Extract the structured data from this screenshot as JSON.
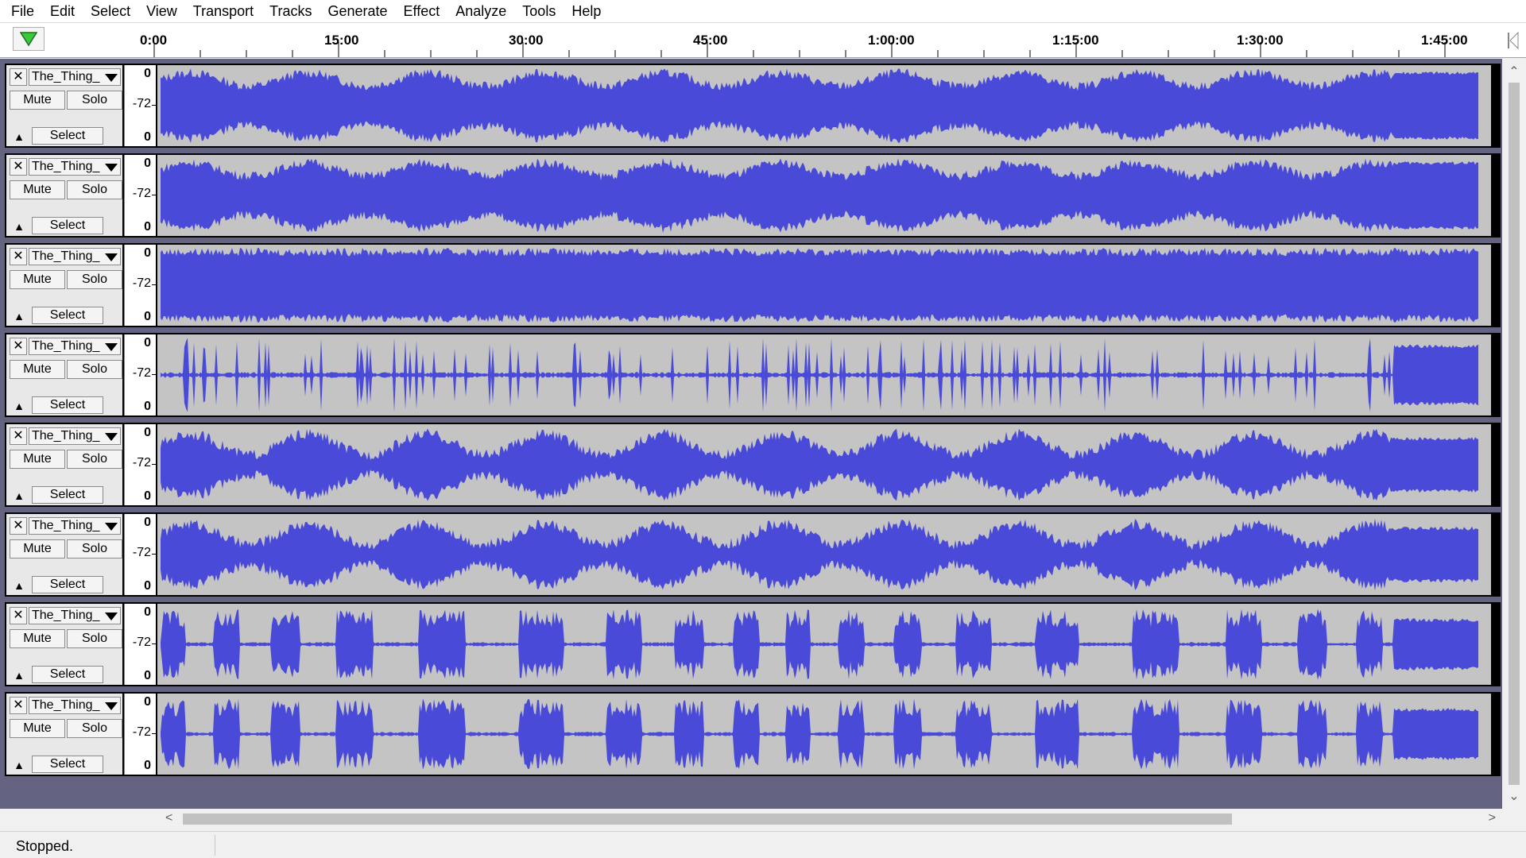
{
  "menu": [
    "File",
    "Edit",
    "Select",
    "View",
    "Transport",
    "Tracks",
    "Generate",
    "Effect",
    "Analyze",
    "Tools",
    "Help"
  ],
  "ruler": {
    "labels": [
      "0:00",
      "15:00",
      "30:00",
      "45:00",
      "1:00:00",
      "1:15:00",
      "1:30:00",
      "1:45:00"
    ],
    "play_icon": "play-triangle-icon"
  },
  "track_common": {
    "close_glyph": "✕",
    "mute_label": "Mute",
    "solo_label": "Solo",
    "select_label": "Select",
    "collapse_glyph": "▲",
    "vruler_top": "0",
    "vruler_mid": "-72",
    "vruler_bot": "0"
  },
  "tracks": [
    {
      "name": "The_Thing_",
      "style": "dense"
    },
    {
      "name": "The_Thing_",
      "style": "dense"
    },
    {
      "name": "The_Thing_",
      "style": "full"
    },
    {
      "name": "The_Thing_",
      "style": "sparse"
    },
    {
      "name": "The_Thing_",
      "style": "bursty"
    },
    {
      "name": "The_Thing_",
      "style": "bursty"
    },
    {
      "name": "The_Thing_",
      "style": "gapped"
    },
    {
      "name": "The_Thing_",
      "style": "gapped"
    }
  ],
  "colors": {
    "waveform": "#4a4ad8",
    "waveform_bg": "#c4c4c4",
    "track_area_bg": "#646482"
  },
  "status": {
    "text": "Stopped."
  }
}
